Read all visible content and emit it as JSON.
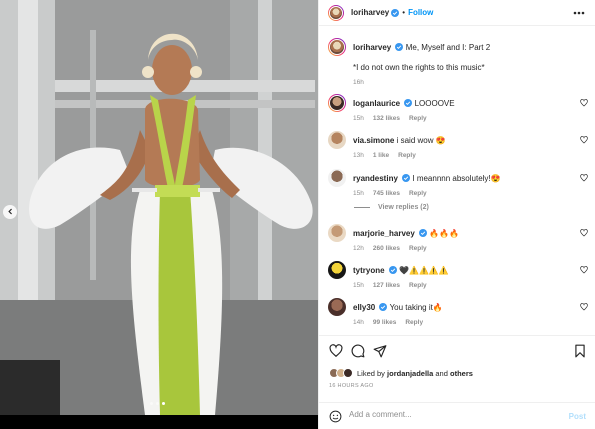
{
  "post": {
    "author": "loriharvey",
    "follow_label": "Follow",
    "separator": "•",
    "caption_user": "loriharvey",
    "caption_text": "Me, Myself and I: Part 2",
    "caption_note": "*I do not own the rights to this music*",
    "caption_age": "16h",
    "posted": "16 HOURS AGO"
  },
  "comments": [
    {
      "user": "loganlaurice",
      "text": "LOOOOVE",
      "age": "15h",
      "likes": "132 likes",
      "reply": "Reply"
    },
    {
      "user": "via.simone",
      "text": "i said wow 😍",
      "age": "13h",
      "likes": "1 like",
      "reply": "Reply"
    },
    {
      "user": "ryandestiny",
      "text": "I meannnn absolutely!😍",
      "age": "15h",
      "likes": "745 likes",
      "reply": "Reply"
    },
    {
      "user": "marjorie_harvey",
      "text": "🔥🔥🔥",
      "age": "12h",
      "likes": "260 likes",
      "reply": "Reply"
    },
    {
      "user": "tytryone",
      "text": "🖤⚠️⚠️⚠️⚠️",
      "age": "15h",
      "likes": "127 likes",
      "reply": "Reply"
    },
    {
      "user": "elly30",
      "text": "You taking it🔥",
      "age": "14h",
      "likes": "99 likes",
      "reply": "Reply"
    }
  ],
  "view_replies": "View replies (2)",
  "liked_by": {
    "prefix": "Liked by",
    "user": "jordanjadella",
    "and": "and",
    "others": "others"
  },
  "add_comment": {
    "placeholder": "Add a comment...",
    "post_label": "Post"
  },
  "icons": [
    "more-icon",
    "verified-icon",
    "heart-icon",
    "comment-icon",
    "share-icon",
    "bookmark-icon",
    "emoji-icon",
    "chevron-left-icon"
  ],
  "colors": {
    "accent": "#0095f6",
    "verified": "#3897f0",
    "muted": "#8e8e8e"
  }
}
